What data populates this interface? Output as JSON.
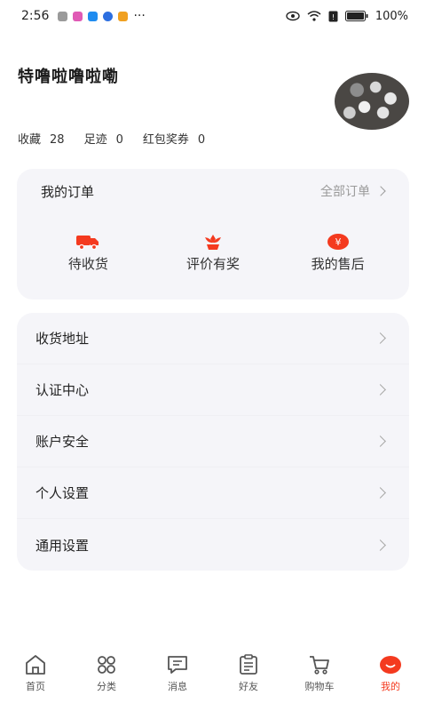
{
  "status_bar": {
    "time": "2:56",
    "battery": "100%",
    "more": "···"
  },
  "profile": {
    "username": "特噜啦噜啦嘞",
    "stats": [
      {
        "label": "收藏",
        "value": "28"
      },
      {
        "label": "足迹",
        "value": "0"
      },
      {
        "label": "红包奖券",
        "value": "0"
      }
    ]
  },
  "orders": {
    "title": "我的订单",
    "all_label": "全部订单",
    "actions": [
      {
        "label": "待收货",
        "icon": "truck-icon"
      },
      {
        "label": "评价有奖",
        "icon": "flower-icon"
      },
      {
        "label": "我的售后",
        "icon": "yen-icon"
      }
    ]
  },
  "menu": {
    "items": [
      {
        "label": "收货地址"
      },
      {
        "label": "认证中心"
      },
      {
        "label": "账户安全"
      },
      {
        "label": "个人设置"
      },
      {
        "label": "通用设置"
      }
    ]
  },
  "nav": {
    "items": [
      {
        "label": "首页",
        "icon": "home-icon"
      },
      {
        "label": "分类",
        "icon": "category-icon"
      },
      {
        "label": "消息",
        "icon": "message-icon"
      },
      {
        "label": "好友",
        "icon": "friends-icon"
      },
      {
        "label": "购物车",
        "icon": "cart-icon"
      },
      {
        "label": "我的",
        "icon": "profile-icon"
      }
    ],
    "active_index": 5
  },
  "colors": {
    "accent": "#f43a1f",
    "card_bg": "#f5f5f9"
  }
}
